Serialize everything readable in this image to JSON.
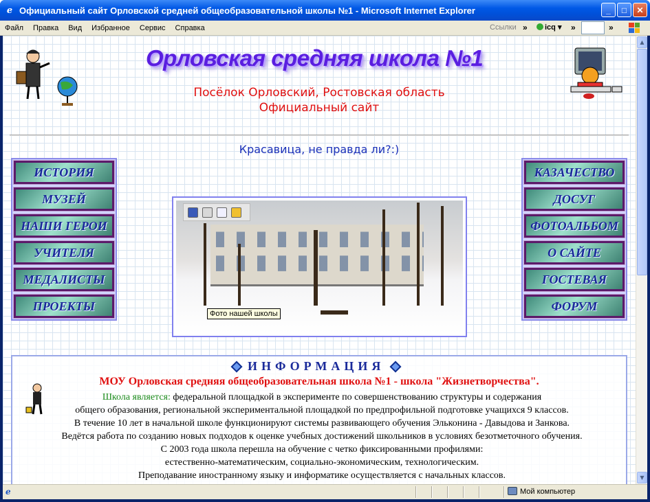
{
  "window": {
    "title": "Официальный сайт Орловской средней общеобразовательной школы №1 - Microsoft Internet Explorer"
  },
  "menubar": {
    "items": [
      "Файл",
      "Правка",
      "Вид",
      "Избранное",
      "Сервис",
      "Справка"
    ],
    "links_label": "Ссылки",
    "icq_label": "icq"
  },
  "page": {
    "school_title": "Орловская средняя школа №1",
    "subtitle_line1": "Посёлок Орловский, Ростовская область",
    "subtitle_line2": "Официальный сайт",
    "tagline": "Красавица, не правда ли?:)",
    "left_nav": [
      "ИСТОРИЯ",
      "МУЗЕЙ",
      "НАШИ ГЕРОИ",
      "УЧИТЕЛЯ",
      "МЕДАЛИСТЫ",
      "ПРОЕКТЫ"
    ],
    "right_nav": [
      "КАЗАЧЕСТВО",
      "ДОСУГ",
      "ФОТОАЛЬБОМ",
      "О САЙТЕ",
      "ГОСТЕВАЯ",
      "ФОРУМ"
    ],
    "photo_caption": "Фото нашей школы",
    "info": {
      "heading": "ИНФОРМАЦИЯ",
      "title": "МОУ Орловская средняя общеобразовательная школа №1 - школа \"Жизнетворчества\".",
      "lead": "Школа является:",
      "line1": " федеральной площадкой в эксперименте по совершенствованию структуры и содержания",
      "line2": "общего образования, региональной экспериментальной площадкой по предпрофильной подготовке учащихся 9 классов.",
      "line3": "В течение 10 лет в начальной школе функционируют системы развивающего обучения Эльконина - Давыдова и Занкова.",
      "line4": "Ведётся работа по созданию новых подходов к оценке учебных достижений школьников в условиях безотметочного обучения.",
      "line5": "С 2003 года школа перешла на обучение с четко фиксированными профилями:",
      "line6": "естественно-математическим, социально-экономическим, технологическим.",
      "line7": "Преподавание иностранному языку и информатике осуществляется с начальных классов."
    }
  },
  "statusbar": {
    "zone": "Мой компьютер"
  }
}
